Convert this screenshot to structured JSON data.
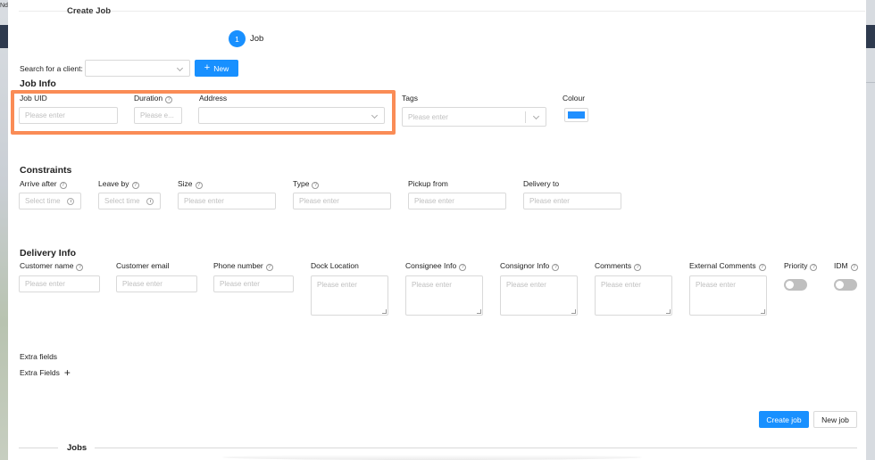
{
  "background": {
    "top_text": "Nd"
  },
  "modal": {
    "title": "Create Job",
    "step": {
      "number": "1",
      "label": "Job"
    }
  },
  "client": {
    "label": "Search for a client:",
    "new_button": "New"
  },
  "job_info": {
    "title": "Job Info",
    "job_uid": {
      "label": "Job UID",
      "placeholder": "Please enter"
    },
    "duration": {
      "label": "Duration",
      "placeholder": "Please e..."
    },
    "address": {
      "label": "Address"
    },
    "tags": {
      "label": "Tags",
      "placeholder": "Please enter"
    },
    "colour": {
      "label": "Colour",
      "value": "#1f8fff"
    }
  },
  "constraints": {
    "title": "Constraints",
    "fields": [
      {
        "label": "Arrive after",
        "placeholder": "Select time"
      },
      {
        "label": "Leave by",
        "placeholder": "Select time"
      },
      {
        "label": "Size",
        "placeholder": "Please enter"
      },
      {
        "label": "Type",
        "placeholder": "Please enter"
      },
      {
        "label": "Pickup from",
        "placeholder": "Please enter"
      },
      {
        "label": "Delivery to",
        "placeholder": "Please enter"
      }
    ]
  },
  "delivery_info": {
    "title": "Delivery Info",
    "fields": [
      {
        "label": "Customer name",
        "placeholder": "Please enter"
      },
      {
        "label": "Customer email",
        "placeholder": "Please enter"
      },
      {
        "label": "Phone number",
        "placeholder": "Please enter"
      },
      {
        "label": "Dock Location",
        "placeholder": "Please enter"
      },
      {
        "label": "Consignee Info",
        "placeholder": "Please enter"
      },
      {
        "label": "Consignor Info",
        "placeholder": "Please enter"
      },
      {
        "label": "Comments",
        "placeholder": "Please enter"
      },
      {
        "label": "External Comments",
        "placeholder": "Please enter"
      }
    ],
    "priority": {
      "label": "Priority",
      "enabled": false
    },
    "idm": {
      "label": "IDM",
      "enabled": false
    }
  },
  "extra": {
    "title": "Extra fields",
    "add_label": "Extra Fields"
  },
  "actions": {
    "create_job": "Create job",
    "new_job": "New job"
  },
  "jobs_divider": {
    "label": "Jobs"
  },
  "colors": {
    "primary": "#1890ff",
    "highlight": "#fa8c56"
  }
}
